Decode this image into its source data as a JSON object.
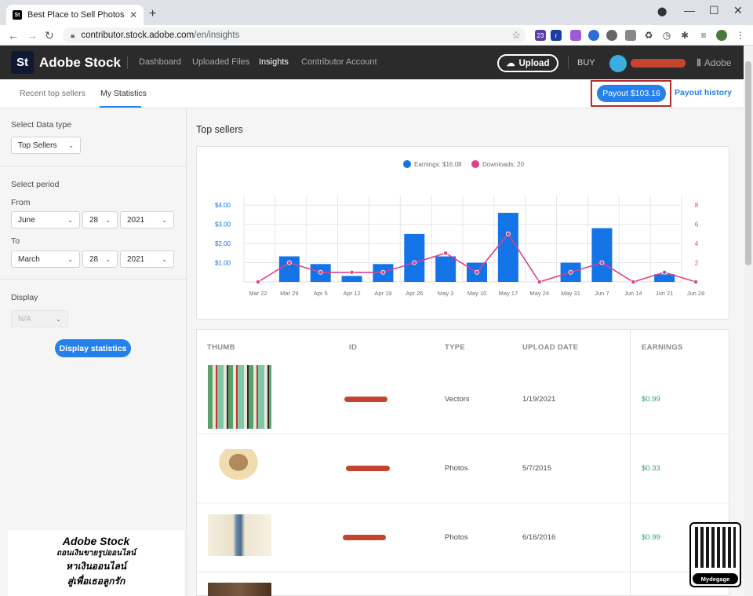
{
  "browser": {
    "tab_title": "Best Place to Sell Photos Online.",
    "tab_favicon": "St",
    "url_host": "contributor.stock.adobe.com",
    "url_path": "/en/insights"
  },
  "header": {
    "logo": "St",
    "brand": "Adobe Stock",
    "nav": [
      "Dashboard",
      "Uploaded Files",
      "Insights",
      "Contributor Account"
    ],
    "active_nav": "Insights",
    "upload_label": "Upload",
    "buy_label": "BUY",
    "adobe_label": "Adobe"
  },
  "subnav": {
    "tabs": [
      "Recent top sellers",
      "My Statistics"
    ],
    "payout_label": "Payout $103.16",
    "payout_history_label": "Payout history"
  },
  "sidebar": {
    "data_type_label": "Select Data type",
    "data_type_value": "Top Sellers",
    "period_label": "Select period",
    "from_label": "From",
    "from_month": "June",
    "from_day": "28",
    "from_year": "2021",
    "to_label": "To",
    "to_month": "March",
    "to_day": "28",
    "to_year": "2021",
    "display_label": "Display",
    "display_value": "N/A",
    "display_button": "Display statistics"
  },
  "promo": {
    "line1": "Adobe Stock",
    "line2": "ถอนเงินขายรูปออนไลน์",
    "line3": "หาเงินออนไลน์",
    "line4": "สู่เพื่อเธอลูกรัก"
  },
  "qr": {
    "label": "Mydegage"
  },
  "main": {
    "title": "Top sellers",
    "table": {
      "headers": [
        "THUMB",
        "ID",
        "TYPE",
        "UPLOAD DATE",
        "EARNINGS"
      ],
      "rows": [
        {
          "type": "Vectors",
          "date": "1/19/2021",
          "earnings": "$0.99"
        },
        {
          "type": "Photos",
          "date": "5/7/2015",
          "earnings": "$0.33"
        },
        {
          "type": "Photos",
          "date": "6/16/2016",
          "earnings": "$0.99"
        }
      ]
    }
  },
  "chart_data": {
    "type": "bar",
    "legend": [
      "Earnings: $16.08",
      "Downloads: 20"
    ],
    "categories": [
      "Mar 22",
      "Mar 29",
      "Apr 5",
      "Apr 12",
      "Apr 19",
      "Apr 26",
      "May 3",
      "May 10",
      "May 17",
      "May 24",
      "May 31",
      "Jun 7",
      "Jun 14",
      "Jun 21",
      "Jun 28"
    ],
    "series": [
      {
        "name": "Earnings: $16.08",
        "type": "bar",
        "color": "#1473e6",
        "values": [
          0,
          1.33,
          0.93,
          0.31,
          0.93,
          2.5,
          1.33,
          1.0,
          3.6,
          0,
          1.0,
          2.8,
          0,
          0.4,
          0
        ]
      },
      {
        "name": "Downloads: 20",
        "type": "line",
        "color": "#e03f86",
        "values": [
          0,
          2,
          1,
          1,
          1,
          2,
          3,
          1,
          5,
          0,
          1,
          2,
          0,
          1,
          0
        ]
      }
    ],
    "y_left_ticks": [
      "$1.00",
      "$2.00",
      "$3.00",
      "$4.00"
    ],
    "y_left_lim": [
      0,
      4.5
    ],
    "y_right_ticks": [
      "2",
      "4",
      "6",
      "8"
    ],
    "y_right_lim": [
      0,
      9
    ],
    "grid": true,
    "legend_position": "top"
  }
}
